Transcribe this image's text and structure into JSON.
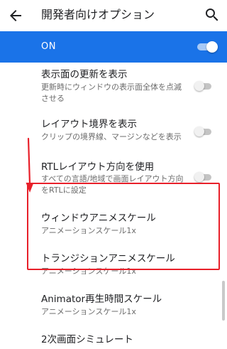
{
  "header": {
    "title": "開発者向けオプション",
    "back_icon": "arrow-back-icon",
    "search_icon": "search-icon"
  },
  "master_switch": {
    "label": "ON",
    "state": "on",
    "color": "#1a73e8"
  },
  "settings": [
    {
      "title": "表示面の更新を表示",
      "lines": [
        "更新時にウィンドウの表示面全体を点滅",
        "させる"
      ],
      "toggle": "off"
    },
    {
      "title": "レイアウト境界を表示",
      "lines": [
        "クリップの境界線、マージンなどを表示"
      ],
      "toggle": "off"
    },
    {
      "title": "RTLレイアウト方向を使用",
      "lines": [
        "すべての言語/地域で画面レイアウト方向",
        "をRTLに設定"
      ],
      "toggle": "off"
    },
    {
      "title": "ウィンドウアニメスケール",
      "lines": [
        "アニメーションスケール1x"
      ]
    },
    {
      "title": "トランジションアニメスケール",
      "lines": [
        "アニメーションスケール1x"
      ]
    },
    {
      "title": "Animator再生時間スケール",
      "lines": [
        "アニメーションスケール1x"
      ]
    },
    {
      "title": "2次画面シミュレート",
      "lines": []
    }
  ],
  "annotation": {
    "highlight_color": "#e8202a"
  }
}
